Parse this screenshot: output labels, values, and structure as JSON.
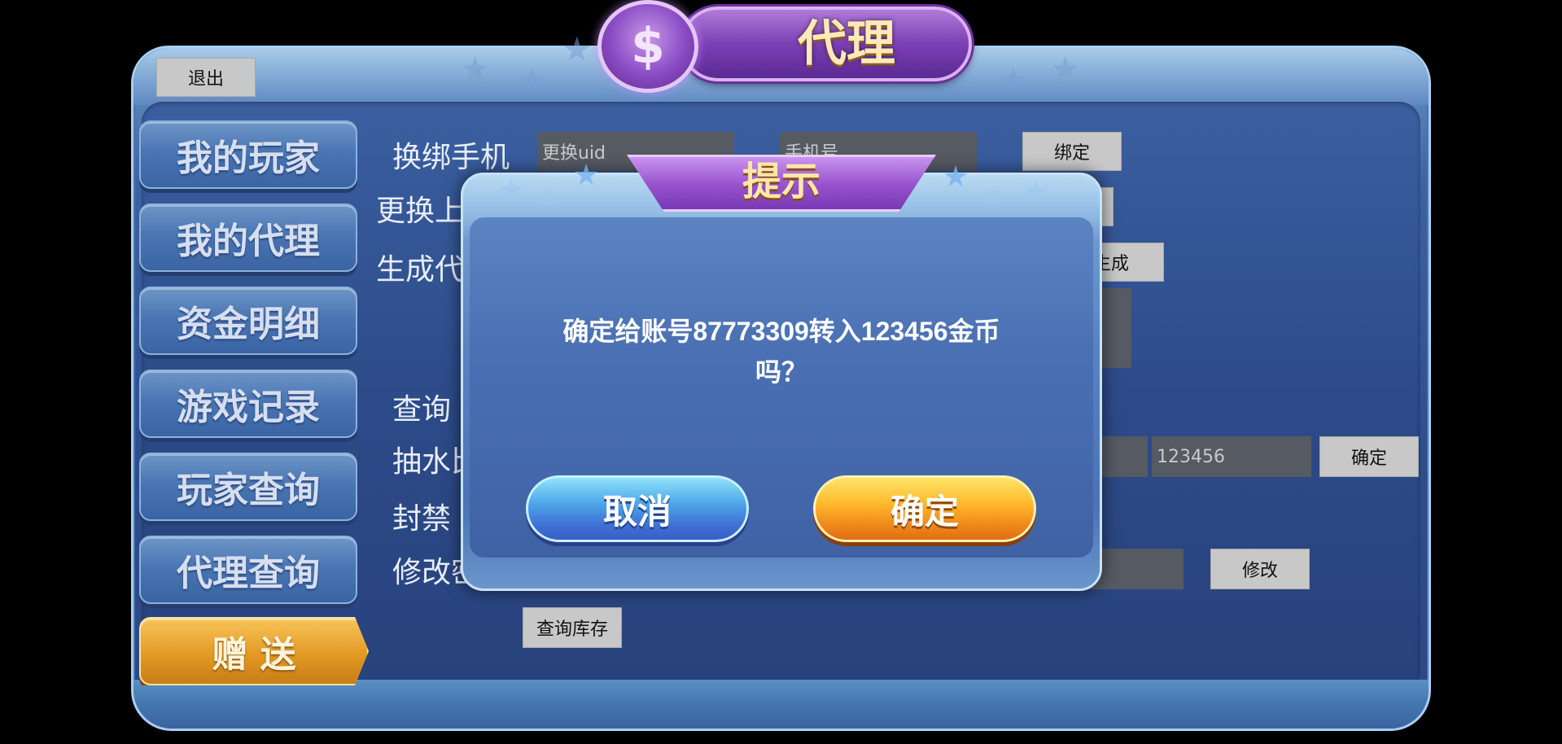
{
  "header": {
    "title": "代理",
    "logo_icon": "dollar-coin-icon",
    "exit_label": "退出"
  },
  "sidebar": {
    "items": [
      {
        "label": "我的玩家",
        "active": false
      },
      {
        "label": "我的代理",
        "active": false
      },
      {
        "label": "资金明细",
        "active": false
      },
      {
        "label": "游戏记录",
        "active": false
      },
      {
        "label": "玩家查询",
        "active": false
      },
      {
        "label": "代理查询",
        "active": false
      },
      {
        "label": "赠 送",
        "active": true
      }
    ]
  },
  "form": {
    "rebind_phone_label": "换绑手机",
    "uid_placeholder": "更换uid",
    "phone_placeholder": "手机号",
    "bind_label": "绑定",
    "change_superior_label": "更换上",
    "generate_label": "生成代",
    "generate_button_label": "生成",
    "query_label": "查询",
    "rake_label": "抽水比",
    "amount_value": "123456",
    "confirm_label": "确定",
    "ban_label": "封禁",
    "modify_password_label": "修改密",
    "modify_label": "修改",
    "query_stock_label": "查询库存"
  },
  "dialog": {
    "title": "提示",
    "message_line1": "确定给账号87773309转入123456金币",
    "message_line2": "吗？",
    "cancel_label": "取消",
    "ok_label": "确定"
  },
  "colors": {
    "active_tab": "#e39a25",
    "panel_blue": "#2e4d8c",
    "title_purple": "#7b3fb5"
  }
}
